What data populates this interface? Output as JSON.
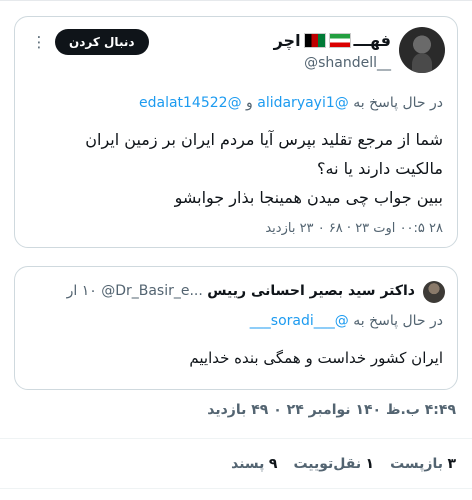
{
  "main_tweet": {
    "display_name_prefix": "فهـــ",
    "display_name_suffix": "اچر",
    "handle": "@shandell__",
    "follow_label": "دنبال کردن",
    "reply_prefix": "در حال پاسخ به",
    "reply_to_1": "@alidaryayi1",
    "reply_and": "و",
    "reply_to_2": "@edalat14522",
    "body_line_1": "شما از مرجع تقلید بپرس آیا مردم ایران بر زمین ایران",
    "body_line_2": "مالکیت دارند یا نه؟",
    "body_line_3": "ببین جواب چی میدن همینجا بذار جوابشو",
    "timestamp": "۲۸ ۰۰:۵ اوت ۲۳",
    "views": "۶۸ ۰ ۲۳ بازدید",
    "colors": {
      "mention": "#1d9bf0",
      "follow_bg": "#0f1419"
    }
  },
  "quoted_tweet": {
    "name": "داکتر سید بصیر احسانی رییس",
    "handle": "@Dr_Basir_e...",
    "time": "۱۰ ار",
    "reply_prefix": "در حال پاسخ به",
    "reply_to": "@___soradi___",
    "body": "ایران کشور خداست و همگی بنده خداییم"
  },
  "tweet_meta": {
    "time_line": "۴:۴۹ ب.ظ ۱۴۰ نوامبر ۲۴ ۰ ۴۹ بازدید"
  },
  "stats": [
    {
      "count": "۳",
      "label": "بازپست"
    },
    {
      "count": "۱",
      "label": "نقل‌توییت"
    },
    {
      "count": "۹",
      "label": "پسند"
    }
  ],
  "icons": {
    "more": "more-options-icon",
    "flag_1": "iran-flag-icon",
    "flag_2": "afghanistan-flag-icon"
  }
}
